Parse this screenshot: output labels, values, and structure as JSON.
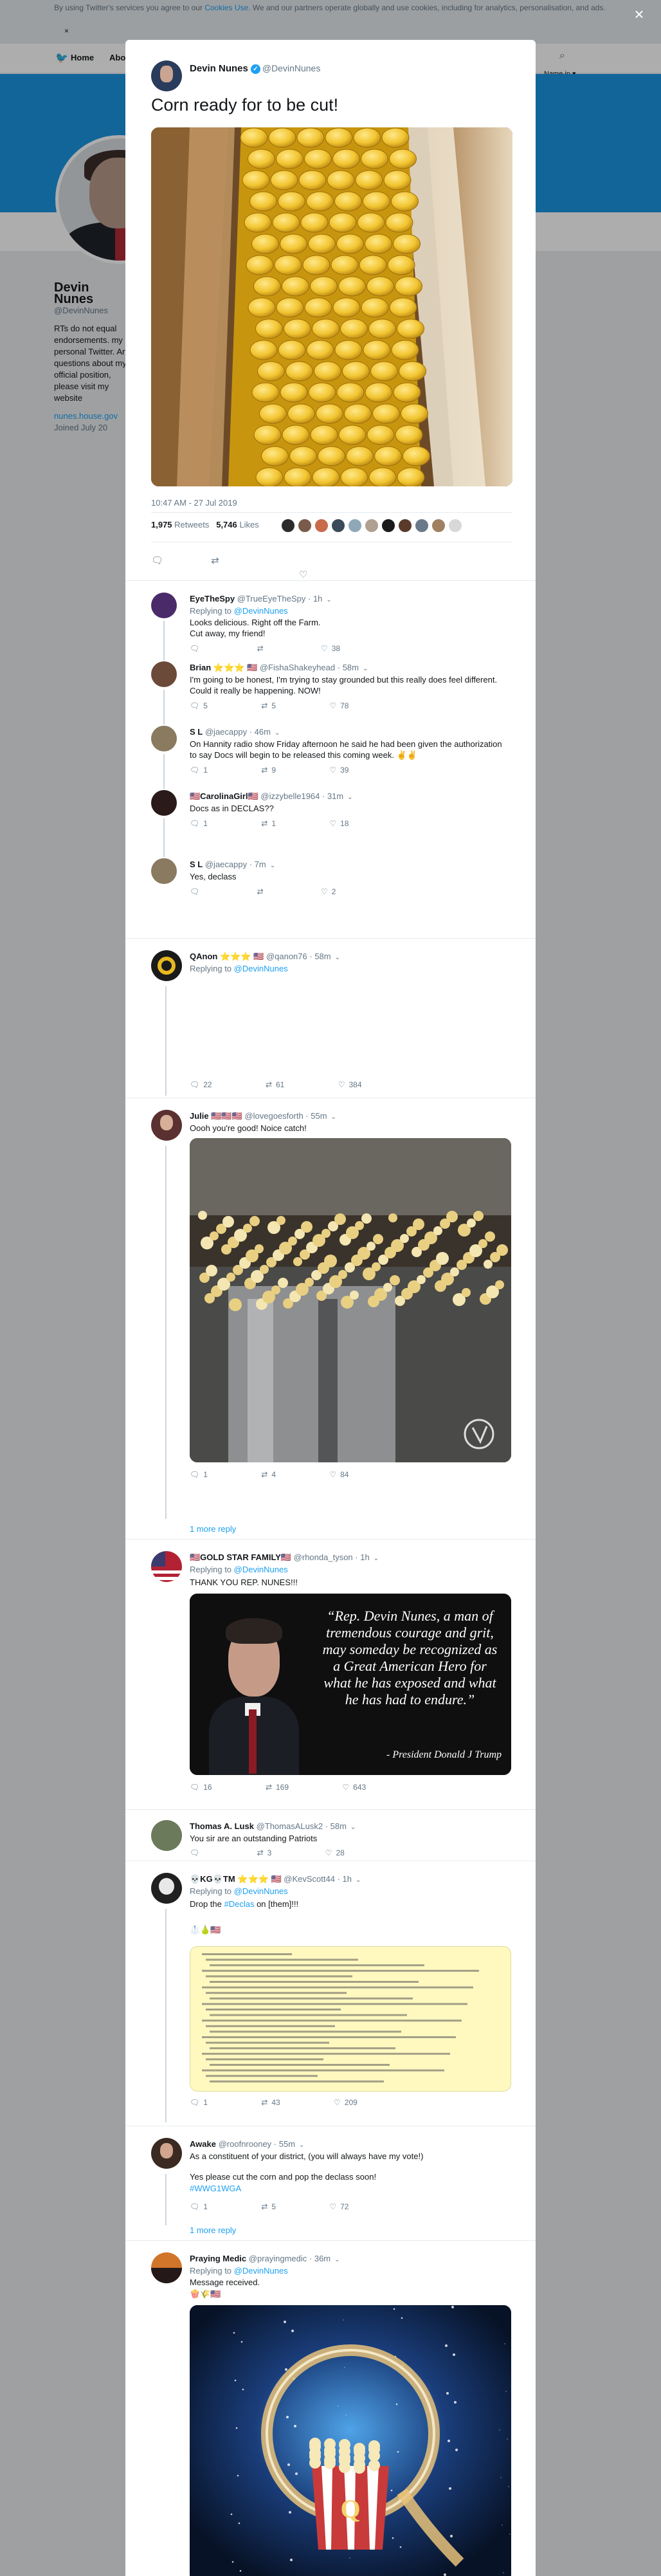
{
  "cookie": {
    "text_before": "By using Twitter's services you agree to our ",
    "link": "Cookies Use",
    "text_after": ". We and our partners operate globally and use cookies, including for analytics, personalisation, and ads.",
    "close": "×"
  },
  "topnav": {
    "home": "Home",
    "about": "Abo",
    "right": "Name in ▾"
  },
  "profile": {
    "name": "Devin Nunes",
    "handle": "@DevinNunes",
    "bio": "RTs do not equal endorsements. my personal Twitter. Any questions about my official position, please visit my website",
    "link": "nunes.house.gov",
    "joined": "Joined July 20"
  },
  "modal_close": "×",
  "main_tweet": {
    "name": "Devin Nunes",
    "handle": "@DevinNunes",
    "text": "Corn ready for to be cut!",
    "time": "10:47 AM - 27 Jul 2019",
    "retweets_count": "1,975",
    "retweets_label": "Retweets",
    "likes_count": "5,746",
    "likes_label": "Likes",
    "liker_colors": [
      "#2b2b2b",
      "#7a5a4a",
      "#c76b4a",
      "#3a4a5a",
      "#8fa8b8",
      "#b0a090",
      "#1a1a1a",
      "#5a3a2a",
      "#6a7a8a",
      "#a08060",
      "#d8d8d8"
    ]
  },
  "replies": [
    {
      "name": "EyeTheSpy",
      "badge": "",
      "handle": "@TrueEyeTheSpy",
      "time": "1h",
      "replying": "Replying to ",
      "replying_to": "@DevinNunes",
      "lines": [
        "Looks delicious. Right off the Farm.",
        "Cut away, my friend!"
      ],
      "reply": "",
      "retweet": "",
      "like": "38",
      "avatar": "#4b2a6a"
    },
    {
      "name": "Brian",
      "badge": "⭐⭐⭐ 🇺🇸",
      "handle": "@FishaShakeyhead",
      "time": "58m",
      "replying": "",
      "replying_to": "",
      "lines": [
        "I'm going to be honest, I'm trying to stay grounded but this really does feel different.  Could it really be happening. NOW!"
      ],
      "reply": "5",
      "retweet": "5",
      "like": "78",
      "avatar": "#6b4a3a"
    },
    {
      "name": "S L",
      "badge": "",
      "handle": "@jaecappy",
      "time": "46m",
      "replying": "",
      "replying_to": "",
      "lines": [
        "On Hannity radio show Friday afternoon he said he had been given the authorization to say Docs will begin to be released this coming week. ✌️✌️"
      ],
      "reply": "1",
      "retweet": "9",
      "like": "39",
      "avatar": "#8a7a60"
    },
    {
      "name": "🇺🇸CarolinaGirl🇺🇸",
      "badge": "",
      "handle": "@izzybelle1964",
      "time": "31m",
      "replying": "",
      "replying_to": "",
      "lines": [
        "Docs as in DECLAS??"
      ],
      "reply": "1",
      "retweet": "1",
      "like": "18",
      "avatar": "#2a1a1a"
    },
    {
      "name": "S L",
      "badge": "",
      "handle": "@jaecappy",
      "time": "7m",
      "replying": "",
      "replying_to": "",
      "lines": [
        "Yes, declass"
      ],
      "reply": "",
      "retweet": "",
      "like": "2",
      "avatar": "#8a7a60"
    }
  ],
  "qanon": {
    "name": "QAnon",
    "badge": "⭐⭐⭐ 🇺🇸",
    "handle": "@qanon76",
    "time": "58m",
    "replying": "Replying to ",
    "replying_to": "@DevinNunes",
    "reply": "22",
    "retweet": "61",
    "like": "384"
  },
  "julie": {
    "name": "Julie",
    "badge": "🇺🇸🇺🇸🇺🇸",
    "handle": "@lovegoesforth",
    "time": "55m",
    "text": "Oooh you're good! Noice catch!",
    "reply": "1",
    "retweet": "4",
    "like": "84",
    "more": "1 more reply"
  },
  "goldstar": {
    "name": "🇺🇸GOLD STAR FAMILY🇺🇸",
    "handle": "@rhonda_tyson",
    "time": "1h",
    "replying": "Replying to ",
    "replying_to": "@DevinNunes",
    "text": "THANK YOU REP. NUNES!!!",
    "quote": "“Rep. Devin Nunes, a man of tremendous courage and grit, may someday be recognized as a Great American Hero for what he has exposed and what he has had to endure.”",
    "attribution": "- President Donald J Trump",
    "reply": "16",
    "retweet": "169",
    "like": "643"
  },
  "lusk": {
    "name": "Thomas A. Lusk",
    "handle": "@ThomasALusk2",
    "time": "58m",
    "text": "You sir are an outstanding Patriots",
    "reply": "",
    "retweet": "3",
    "like": "28"
  },
  "kg": {
    "name": "💀KG💀TM",
    "badge": "⭐⭐⭐ 🇺🇸",
    "handle": "@KevScott44",
    "time": "1h",
    "replying": "Replying to ",
    "replying_to": "@DevinNunes",
    "text_pre": "Drop the ",
    "text_tag": "#Declas",
    "text_post": " on [them]!!!",
    "emoji": "🥼🍐🇺🇸",
    "reply": "1",
    "retweet": "43",
    "like": "209"
  },
  "awake": {
    "name": "Awake",
    "handle": "@roofnrooney",
    "time": "55m",
    "line1": "As a constituent of your district, (you will always have my vote!)",
    "line2": "Yes please cut the corn and pop the declass soon!",
    "tag": "#WWG1WGA",
    "reply": "1",
    "retweet": "5",
    "like": "72",
    "more": "1 more reply"
  },
  "medic": {
    "name": "Praying Medic",
    "handle": "@prayingmedic",
    "time": "36m",
    "replying": "Replying to ",
    "replying_to": "@DevinNunes",
    "text": "Message received.",
    "emoji": "🍿🌾🇺🇸",
    "art_letter": "Q"
  }
}
